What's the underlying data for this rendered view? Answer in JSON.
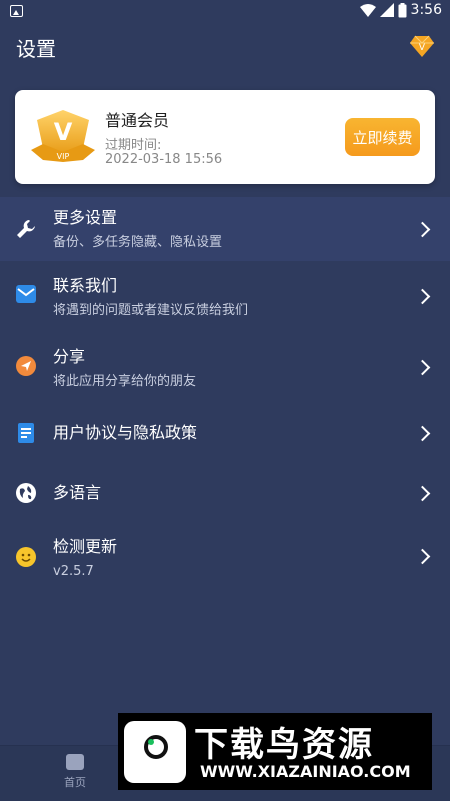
{
  "status_bar": {
    "time": "3:56",
    "battery": "8"
  },
  "header": {
    "title": "设置"
  },
  "vip_card": {
    "badge_text": "VIP",
    "badge_letter": "V",
    "title": "普通会员",
    "expire_label": "过期时间:",
    "expire_date": "2022-03-18 15:56",
    "renew_label": "立即续费"
  },
  "menu": [
    {
      "title": "更多设置",
      "subtitle": "备份、多任务隐藏、隐私设置",
      "icon": "wrench-icon"
    },
    {
      "title": "联系我们",
      "subtitle": "将遇到的问题或者建议反馈给我们",
      "icon": "mail-icon"
    },
    {
      "title": "分享",
      "subtitle": "将此应用分享给你的朋友",
      "icon": "share-icon"
    },
    {
      "title": "用户协议与隐私政策",
      "subtitle": "",
      "icon": "document-icon"
    },
    {
      "title": "多语言",
      "subtitle": "",
      "icon": "globe-icon"
    },
    {
      "title": "检测更新",
      "subtitle": "v2.5.7",
      "icon": "smiley-icon"
    }
  ],
  "bottom_nav": {
    "home_label": "首页"
  },
  "watermark": {
    "text": "下载鸟资源",
    "url": "WWW.XIAZAINIAO.COM"
  },
  "colors": {
    "background": "#2f3b5e",
    "accent": "#f5a623",
    "card": "#ffffff"
  }
}
